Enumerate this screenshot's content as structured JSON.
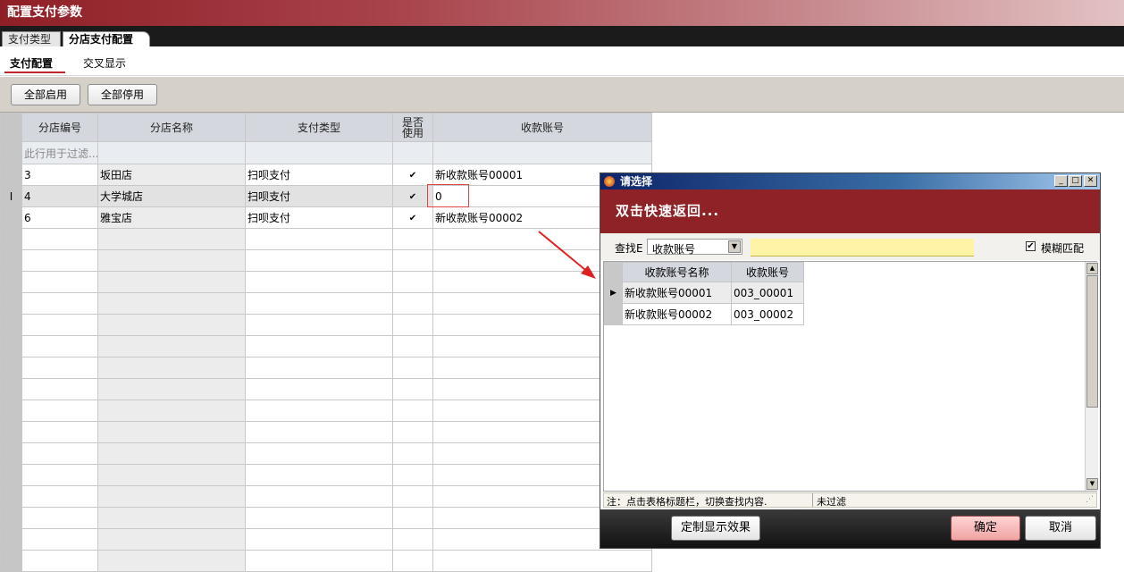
{
  "window": {
    "title": "配置支付参数"
  },
  "tabs": [
    {
      "label": "支付类型",
      "active": false
    },
    {
      "label": "分店支付配置",
      "active": true
    }
  ],
  "subtabs": [
    {
      "label": "支付配置",
      "active": true
    },
    {
      "label": "交叉显示",
      "active": false
    }
  ],
  "toolbar": {
    "enable_all": "全部启用",
    "disable_all": "全部停用"
  },
  "grid": {
    "columns": [
      "分店编号",
      "分店名称",
      "支付类型",
      "是否使用",
      "收款账号"
    ],
    "filter_placeholder": "此行用于过滤...",
    "rows": [
      {
        "id": "3",
        "name": "坂田店",
        "pay_type": "扫呗支付",
        "enabled": true,
        "account": "新收款账号00001"
      },
      {
        "id": "4",
        "name": "大学城店",
        "pay_type": "扫呗支付",
        "enabled": true,
        "account": "0",
        "selected": true
      },
      {
        "id": "6",
        "name": "雅宝店",
        "pay_type": "扫呗支付",
        "enabled": true,
        "account": "新收款账号00002"
      }
    ],
    "current_row_indicator": "I",
    "checkmark": "✔"
  },
  "dialog": {
    "title": "请选择",
    "banner": "双击快速返回...",
    "search_label": "查找E",
    "search_field": "收款账号",
    "search_value": "",
    "fuzzy_checked": true,
    "fuzzy_label": "模糊匹配",
    "columns": [
      "收款账号名称",
      "收款账号"
    ],
    "rows": [
      {
        "name": "新收款账号00001",
        "code": "003_00001",
        "selected": true
      },
      {
        "name": "新收款账号00002",
        "code": "003_00002"
      }
    ],
    "status_note": "注：点击表格标题栏，切换查找内容.",
    "status_filter": "未过滤",
    "buttons": {
      "custom": "定制显示效果",
      "ok": "确定",
      "cancel": "取消"
    }
  },
  "colors": {
    "title_red": "#8f1f27",
    "banner_red": "#8f2227",
    "search_yellow": "#fff3a6",
    "highlight_box": "#e04646",
    "arrow": "#e02020"
  }
}
